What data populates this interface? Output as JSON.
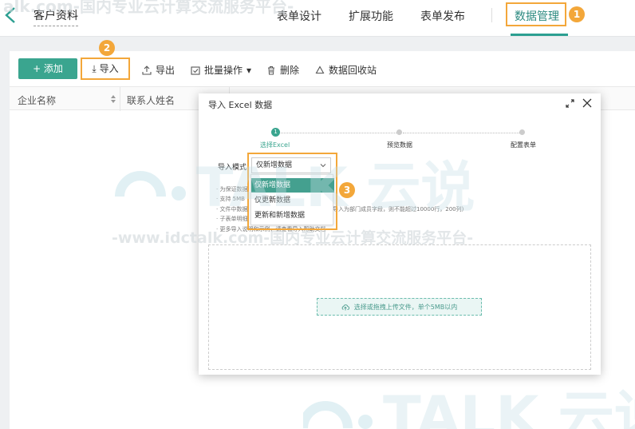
{
  "watermark": {
    "top_text": "alk.com-国内专业云计算交流服务平台-",
    "mid_text": "-www.idctalk.com-国内专业云计算交流服务平台-",
    "logo_text": "TALK 云说"
  },
  "header": {
    "title": "客户资料",
    "tabs": [
      "表单设计",
      "扩展功能",
      "表单发布",
      "数据管理"
    ],
    "active_tab_index": 3,
    "step_badge_1": "1"
  },
  "toolbar": {
    "add_label": "+ 添加",
    "import_label": "导入",
    "export_label": "导出",
    "batch_label": "批量操作",
    "delete_label": "删除",
    "recycle_label": "数据回收站",
    "step_badge_2": "2"
  },
  "table": {
    "columns": [
      "企业名称",
      "联系人姓名"
    ]
  },
  "dialog": {
    "title": "导入 Excel 数据",
    "steps": [
      "选择Excel",
      "预览数据",
      "配置表单"
    ],
    "current_step_number": "1",
    "mode_label": "导入模式",
    "mode_value": "仅新增数据",
    "step_badge_3": "3",
    "mode_options": [
      "仅新增数据",
      "仅更新数据",
      "更新和新增数据"
    ],
    "notes": [
      "· 为保证数据",
      "· 支持 5MB",
      "· 文件中数据",
      "· 子表单明细",
      "· 更多导入说明和示例，请查看导入帮助文档"
    ],
    "note_right": "导入为部门成员字段，则不能超过10000行，200列)",
    "upload_label": "选择或拖拽上传文件，单个5MB以内"
  },
  "colors": {
    "accent": "#3aa58f",
    "highlight": "#f3a73a"
  }
}
